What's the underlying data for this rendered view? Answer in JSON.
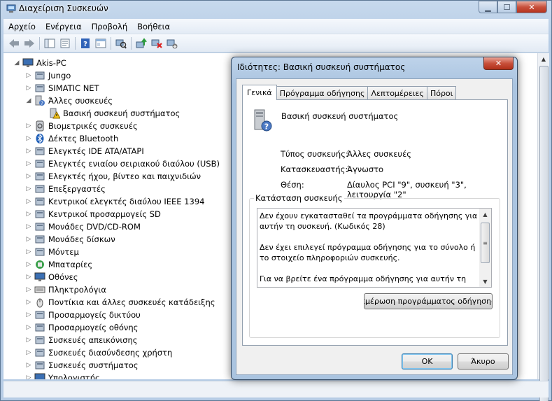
{
  "window": {
    "title": "Διαχείριση Συσκευών"
  },
  "menubar": [
    "Αρχείο",
    "Ενέργεια",
    "Προβολή",
    "Βοήθεια"
  ],
  "tree": {
    "root": "Akis-PC",
    "items": [
      {
        "label": "Jungo",
        "expander": "▷",
        "icon": "usb-controller-icon"
      },
      {
        "label": "SIMATIC NET",
        "expander": "▷",
        "icon": "network-icon"
      },
      {
        "label": "Άλλες συσκευές",
        "expander": "◢",
        "icon": "unknown-device-icon"
      },
      {
        "label": "Βασική συσκευή συστήματος",
        "expander": "",
        "icon": "warning-device-icon",
        "child": true
      },
      {
        "label": "Βιομετρικές συσκευές",
        "expander": "▷",
        "icon": "fingerprint-icon"
      },
      {
        "label": "Δέκτες Bluetooth",
        "expander": "▷",
        "icon": "bluetooth-icon"
      },
      {
        "label": "Ελεγκτές IDE ATA/ATAPI",
        "expander": "▷",
        "icon": "ide-controller-icon"
      },
      {
        "label": "Ελεγκτές ενιαίου σειριακού διαύλου (USB)",
        "expander": "▷",
        "icon": "usb-icon"
      },
      {
        "label": "Ελεγκτές ήχου, βίντεο και παιχνιδιών",
        "expander": "▷",
        "icon": "sound-icon"
      },
      {
        "label": "Επεξεργαστές",
        "expander": "▷",
        "icon": "processor-icon"
      },
      {
        "label": "Κεντρικοί ελεγκτές διαύλου IEEE 1394",
        "expander": "▷",
        "icon": "firewire-icon"
      },
      {
        "label": "Κεντρικοί προσαρμογείς SD",
        "expander": "▷",
        "icon": "sd-host-icon"
      },
      {
        "label": "Μονάδες DVD/CD-ROM",
        "expander": "▷",
        "icon": "dvd-drive-icon"
      },
      {
        "label": "Μονάδες δίσκων",
        "expander": "▷",
        "icon": "disk-drive-icon"
      },
      {
        "label": "Μόντεμ",
        "expander": "▷",
        "icon": "modem-icon"
      },
      {
        "label": "Μπαταρίες",
        "expander": "▷",
        "icon": "battery-icon"
      },
      {
        "label": "Οθόνες",
        "expander": "▷",
        "icon": "monitor-icon"
      },
      {
        "label": "Πληκτρολόγια",
        "expander": "▷",
        "icon": "keyboard-icon"
      },
      {
        "label": "Ποντίκια και άλλες συσκευές κατάδειξης",
        "expander": "▷",
        "icon": "mouse-icon"
      },
      {
        "label": "Προσαρμογείς δικτύου",
        "expander": "▷",
        "icon": "network-adapter-icon"
      },
      {
        "label": "Προσαρμογείς οθόνης",
        "expander": "▷",
        "icon": "display-adapter-icon"
      },
      {
        "label": "Συσκευές απεικόνισης",
        "expander": "▷",
        "icon": "imaging-icon"
      },
      {
        "label": "Συσκευές διασύνδεσης χρήστη",
        "expander": "▷",
        "icon": "hid-icon"
      },
      {
        "label": "Συσκευές συστήματος",
        "expander": "▷",
        "icon": "system-device-icon"
      },
      {
        "label": "Υπολογιστής",
        "expander": "▷",
        "icon": "computer-icon"
      }
    ]
  },
  "dialog": {
    "title": "Ιδιότητες: Βασική συσκευή συστήματος",
    "close": "✕",
    "tabs": [
      "Γενικά",
      "Πρόγραμμα οδήγησης",
      "Λεπτομέρειες",
      "Πόροι"
    ],
    "device_name": "Βασική συσκευή συστήματος",
    "properties": [
      {
        "label": "Τύπος συσκευής:",
        "value": "Άλλες συσκευές"
      },
      {
        "label": "Κατασκευαστής:",
        "value": "Άγνωστο"
      },
      {
        "label": "Θέση:",
        "value": "Δίαυλος PCI \"9\", συσκευή \"3\", λειτουργία \"2\""
      }
    ],
    "status_group": "Κατάσταση συσκευής",
    "status_text": [
      "Δεν έχουν εγκατασταθεί τα προγράμματα οδήγησης για αυτήν τη συσκευή. (Κωδικός 28)",
      "Δεν έχει επιλεγεί πρόγραμμα οδήγησης για το σύνολο ή το στοιχείο πληροφοριών συσκευής.",
      "Για να βρείτε ένα πρόγραμμα οδήγησης για αυτήν τη"
    ],
    "update_driver_button": "πμέρωση προγράμματος οδήγησης",
    "ok_button": "OK",
    "cancel_button": "Άκυρο"
  }
}
